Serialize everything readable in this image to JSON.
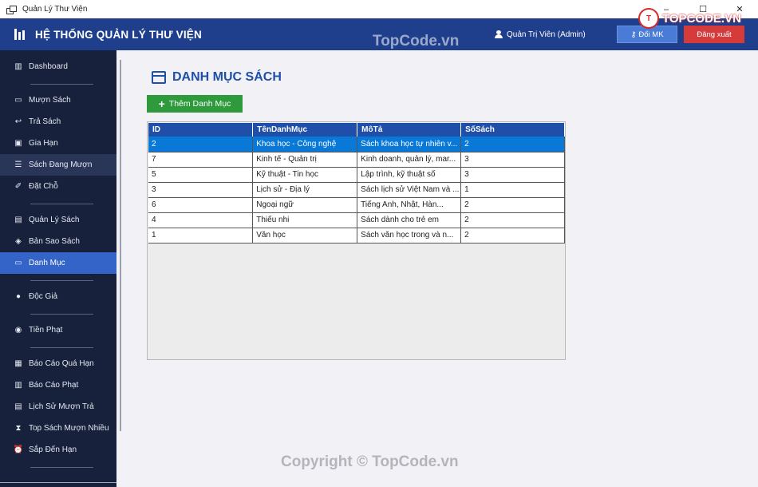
{
  "window": {
    "title": "Quản Lý Thư Viện",
    "controls": [
      "–",
      "☐",
      "✕"
    ]
  },
  "header": {
    "title": "HỆ THỐNG QUẢN LÝ THƯ VIỆN",
    "user": "Quản Trị Viên  (Admin)",
    "change_password": "Đổi MK",
    "logout": "Đăng xuất",
    "bg_color": "#1f3f8c"
  },
  "sidebar": {
    "items": [
      {
        "label": "Dashboard",
        "icon": "chart-icon"
      },
      {
        "label": "Mượn Sách",
        "icon": "book-icon"
      },
      {
        "label": "Trả Sách",
        "icon": "return-icon"
      },
      {
        "label": "Gia Hạn",
        "icon": "extend-icon"
      },
      {
        "label": "Sách Đang Mượn",
        "icon": "list-icon",
        "state": "hover"
      },
      {
        "label": "Đặt Chỗ",
        "icon": "pin-icon"
      },
      {
        "label": "Quản Lý Sách",
        "icon": "books-icon"
      },
      {
        "label": "Bản Sao Sách",
        "icon": "box-icon"
      },
      {
        "label": "Danh Mục",
        "icon": "folder-icon",
        "state": "active"
      },
      {
        "label": "Độc Giả",
        "icon": "user-icon"
      },
      {
        "label": "Tiền Phạt",
        "icon": "money-icon"
      },
      {
        "label": "Báo Cáo Quá Hạn",
        "icon": "report-icon"
      },
      {
        "label": "Báo Cáo Phạt",
        "icon": "chart-icon"
      },
      {
        "label": "Lịch Sử Mượn Trả",
        "icon": "history-icon"
      },
      {
        "label": "Top Sách Mượn Nhiều",
        "icon": "hourglass-icon"
      },
      {
        "label": "Sắp Đến Hạn",
        "icon": "alarm-icon"
      }
    ],
    "active_color": "#3564c8"
  },
  "main": {
    "title": "DANH MỤC SÁCH",
    "add_button": "Thêm Danh Mục",
    "table": {
      "columns": [
        "ID",
        "TênDanhMục",
        "MôTả",
        "SốSách"
      ],
      "rows": [
        [
          "2",
          "Khoa học - Công nghệ",
          "Sách khoa học tự nhiên v...",
          "2"
        ],
        [
          "7",
          "Kinh tế - Quản trị",
          "Kinh doanh, quản lý, mar...",
          "3"
        ],
        [
          "5",
          "Kỹ thuật - Tin học",
          "Lập trình, kỹ thuật số",
          "3"
        ],
        [
          "3",
          "Lịch sử - Địa lý",
          "Sách lịch sử Việt Nam và ...",
          "1"
        ],
        [
          "6",
          "Ngoại ngữ",
          "Tiếng Anh, Nhật, Hàn...",
          "2"
        ],
        [
          "4",
          "Thiếu nhi",
          "Sách dành cho trẻ em",
          "2"
        ],
        [
          "1",
          "Văn học",
          "Sách văn học trong và n...",
          "2"
        ]
      ],
      "selected_row": 0
    }
  },
  "watermarks": {
    "top": "TopCode.vn",
    "bottom": "Copyright © TopCode.vn",
    "logo": "TOPCODE.VN"
  }
}
